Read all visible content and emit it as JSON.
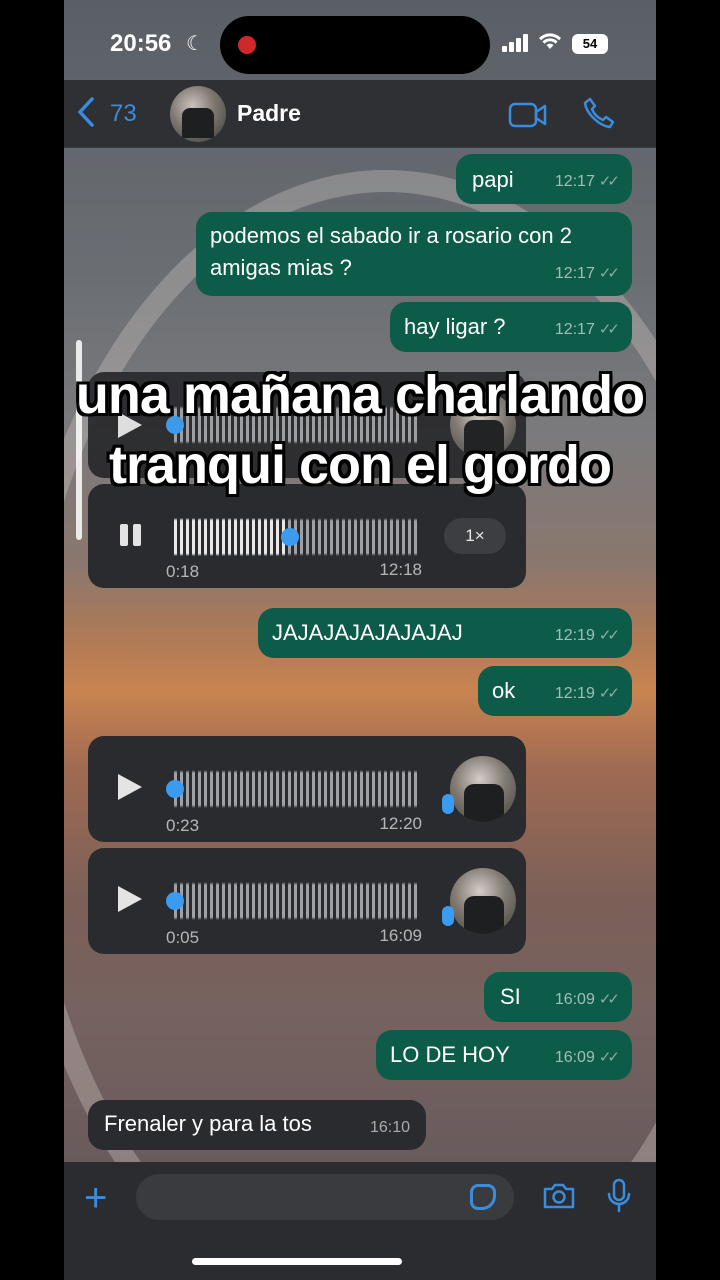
{
  "status_bar": {
    "time": "20:56",
    "battery": "54"
  },
  "header": {
    "back_count": "73",
    "contact_name": "Padre"
  },
  "messages": [
    {
      "text": "papi",
      "time": "12:17"
    },
    {
      "text": "podemos el sabado ir a rosario con 2 amigas mias ?",
      "time": "12:17"
    },
    {
      "text": "hay ligar ?",
      "time": "12:17"
    },
    {
      "text": "JAJAJAJAJAJAJAJ",
      "time": "12:19"
    },
    {
      "text": "ok",
      "time": "12:19"
    },
    {
      "text": "SI",
      "time": "16:09"
    },
    {
      "text": "LO DE HOY",
      "time": "16:09"
    },
    {
      "text": "Frenaler y para la tos",
      "time": "16:10"
    }
  ],
  "voice_notes": [
    {
      "duration": "0:18",
      "time": "12:18",
      "speed": "1×",
      "progress": 0.47
    },
    {
      "duration": "0:23",
      "time": "12:20",
      "progress": 0.0
    },
    {
      "duration": "0:05",
      "time": "16:09",
      "progress": 0.0
    }
  ],
  "overlay_caption": "una mañana charlando tranqui con el gordo",
  "colors": {
    "accent": "#3a8dde",
    "outgoing_bubble": "#0d5c49",
    "incoming_bubble": "#2a2b2e"
  }
}
